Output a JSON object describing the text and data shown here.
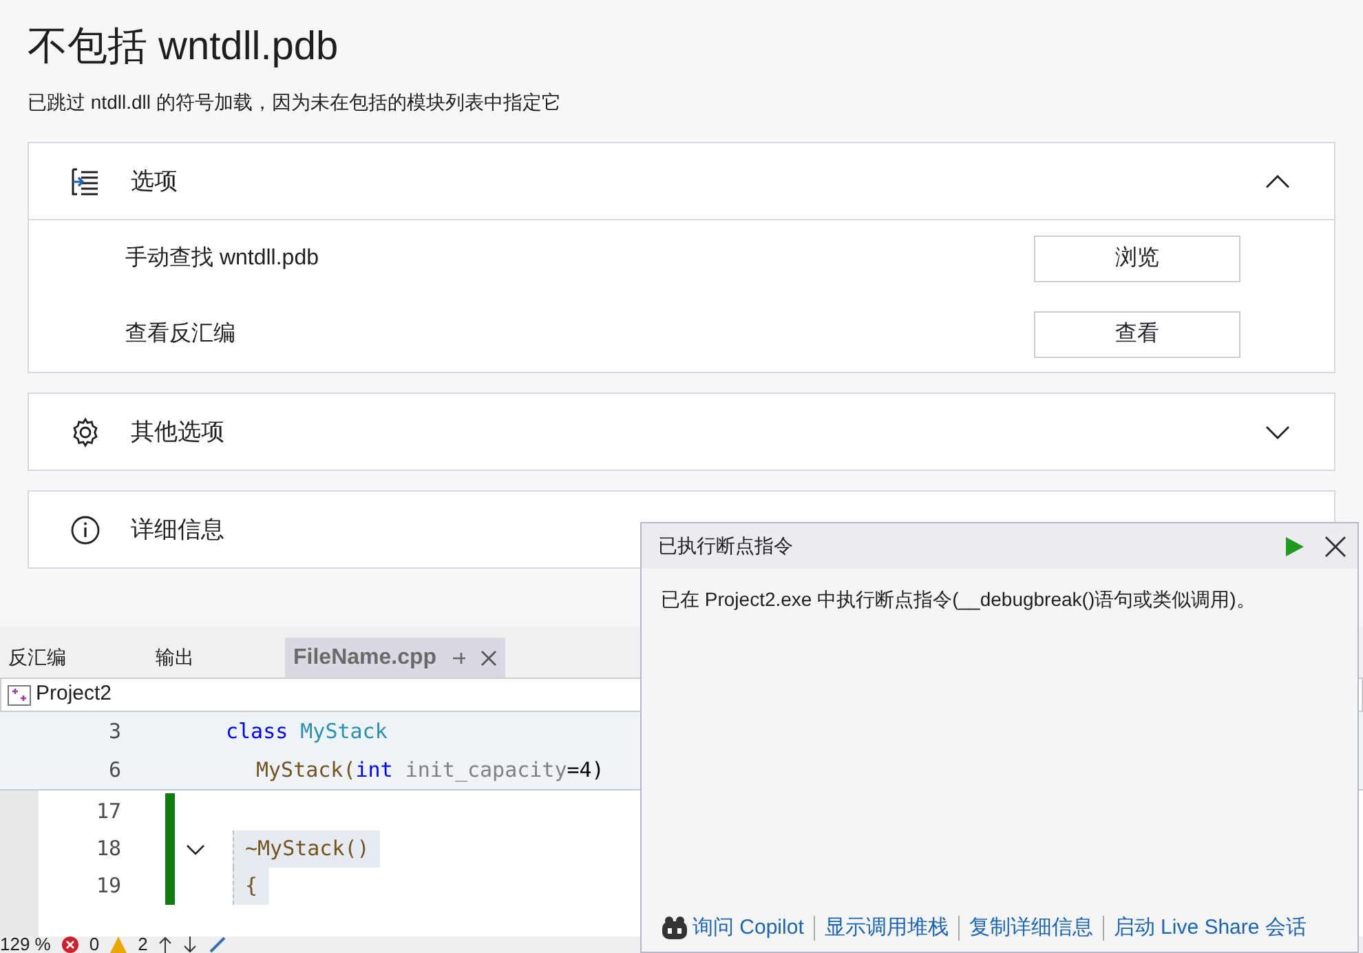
{
  "page": {
    "title": "不包括 wntdll.pdb",
    "subtitle": "已跳过 ntdll.dll 的符号加载，因为未在包括的模块列表中指定它"
  },
  "sections": [
    {
      "title": "选项",
      "expanded": true,
      "rows": [
        {
          "label": "手动查找 wntdll.pdb",
          "button": "浏览"
        },
        {
          "label": "查看反汇编",
          "button": "查看"
        }
      ]
    },
    {
      "title": "其他选项",
      "expanded": false
    },
    {
      "title": "详细信息",
      "expanded": false
    }
  ],
  "editor": {
    "tabs": [
      {
        "label": "反汇编",
        "selected": false
      },
      {
        "label": "输出",
        "selected": false
      },
      {
        "label": "FileName.cpp",
        "selected": true
      }
    ],
    "project": "Project2",
    "sticky_lines": [
      {
        "number": "3",
        "tokens": [
          {
            "kind": "keyword",
            "text": "class"
          },
          {
            "kind": "type",
            "text": "MyStack"
          }
        ]
      },
      {
        "number": "6",
        "tokens": [
          {
            "kind": "func",
            "text": "MyStack("
          },
          {
            "kind": "keyword",
            "text": "int"
          },
          {
            "kind": "param",
            "text": "init_capacity"
          },
          {
            "kind": "plain",
            "text": "=4)"
          }
        ]
      }
    ],
    "lines": [
      {
        "number": "17",
        "fold": false
      },
      {
        "number": "18",
        "fold": true,
        "tokens": [
          {
            "kind": "func",
            "text": "~MyStack()"
          }
        ]
      },
      {
        "number": "19",
        "fold": false,
        "tokens": [
          {
            "kind": "func",
            "text": "{"
          }
        ]
      }
    ],
    "status": {
      "zoom": "129 %",
      "errors": "0",
      "warnings": "2"
    }
  },
  "popup": {
    "title": "已执行断点指令",
    "message": "已在 Project2.exe 中执行断点指令(__debugbreak()语句或类似调用)。",
    "links": [
      "询问 Copilot",
      "显示调用堆栈",
      "复制详细信息",
      "启动 Live Share 会话"
    ]
  }
}
